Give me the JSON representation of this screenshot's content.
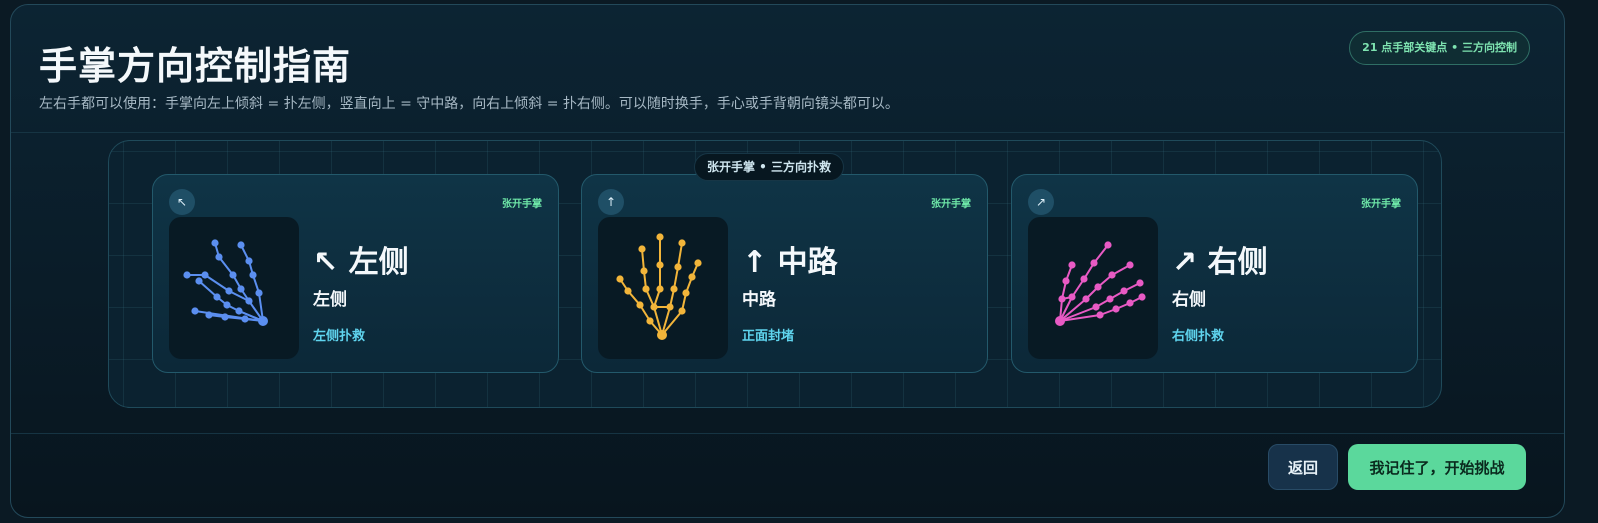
{
  "header": {
    "title": "手掌方向控制指南",
    "subtitle": "左右手都可以使用：手掌向左上倾斜 = 扑左侧，竖直向上 = 守中路，向右上倾斜 = 扑右侧。可以随时换手，手心或手背朝向镜头都可以。",
    "badge": "21 点手部关键点 • 三方向控制"
  },
  "stage": {
    "pill": "张开手掌 • 三方向扑救"
  },
  "cards": [
    {
      "icon": "↖",
      "icon_name": "arrow-up-left-icon",
      "tag": "张开手掌",
      "direction": "↖ 左侧",
      "label": "左侧",
      "action": "左侧扑救",
      "hand_color": "#5b8ff0"
    },
    {
      "icon": "↑",
      "icon_name": "arrow-up-icon",
      "tag": "张开手掌",
      "direction": "↑ 中路",
      "label": "中路",
      "action": "正面封堵",
      "hand_color": "#f2b53a"
    },
    {
      "icon": "↗",
      "icon_name": "arrow-up-right-icon",
      "tag": "张开手掌",
      "direction": "↗ 右侧",
      "label": "右侧",
      "action": "右侧扑救",
      "hand_color": "#e85ac4"
    }
  ],
  "footer": {
    "back_label": "返回",
    "start_label": "我记住了，开始挑战"
  },
  "colors": {
    "accent_green": "#5bd89c",
    "accent_cyan": "#5fd4ee",
    "tag_green": "#6ee7a8"
  }
}
